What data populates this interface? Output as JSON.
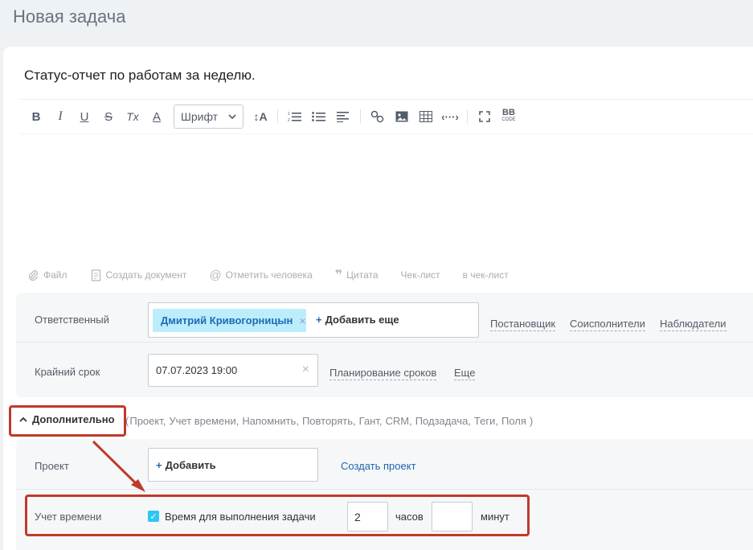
{
  "page": {
    "title": "Новая задача"
  },
  "task": {
    "title": "Статус-отчет по работам за неделю."
  },
  "toolbar": {
    "bold": "B",
    "italic": "I",
    "underline": "U",
    "strike": "S",
    "clear": "Tx",
    "color": "A",
    "font_select": "Шрифт",
    "font_size": "↕A",
    "bb_code": "BB"
  },
  "attach": {
    "file": "Файл",
    "create_doc": "Создать документ",
    "mention": "Отметить человека",
    "quote": "Цитата",
    "checklist": "Чек-лист",
    "to_checklist": "в чек-лист"
  },
  "responsible": {
    "label": "Ответственный",
    "person": "Дмитрий Кривогорницын",
    "add_more": "Добавить еще",
    "links": [
      "Постановщик",
      "Соисполнители",
      "Наблюдатели"
    ]
  },
  "deadline": {
    "label": "Крайний срок",
    "value": "07.07.2023 19:00",
    "planning": "Планирование сроков",
    "more": "Еще"
  },
  "additional": {
    "toggle": "Дополнительно",
    "list_open": "(",
    "items": [
      "Проект,",
      "Учет времени,",
      "Напомнить,",
      "Повторять,",
      "Гант,",
      "CRM,",
      "Подзадача,",
      "Теги,",
      "Поля"
    ],
    "list_close": ")"
  },
  "project": {
    "label": "Проект",
    "add": "Добавить",
    "create": "Создать проект"
  },
  "time_tracking": {
    "label": "Учет времени",
    "checkbox_label": "Время для выполнения задачи",
    "hours_value": "2",
    "hours_unit": "часов",
    "minutes_value": "",
    "minutes_unit": "минут"
  },
  "colors": {
    "accent": "#2fc6f6",
    "chip": "#bcedfc",
    "highlight": "#c0392b"
  }
}
